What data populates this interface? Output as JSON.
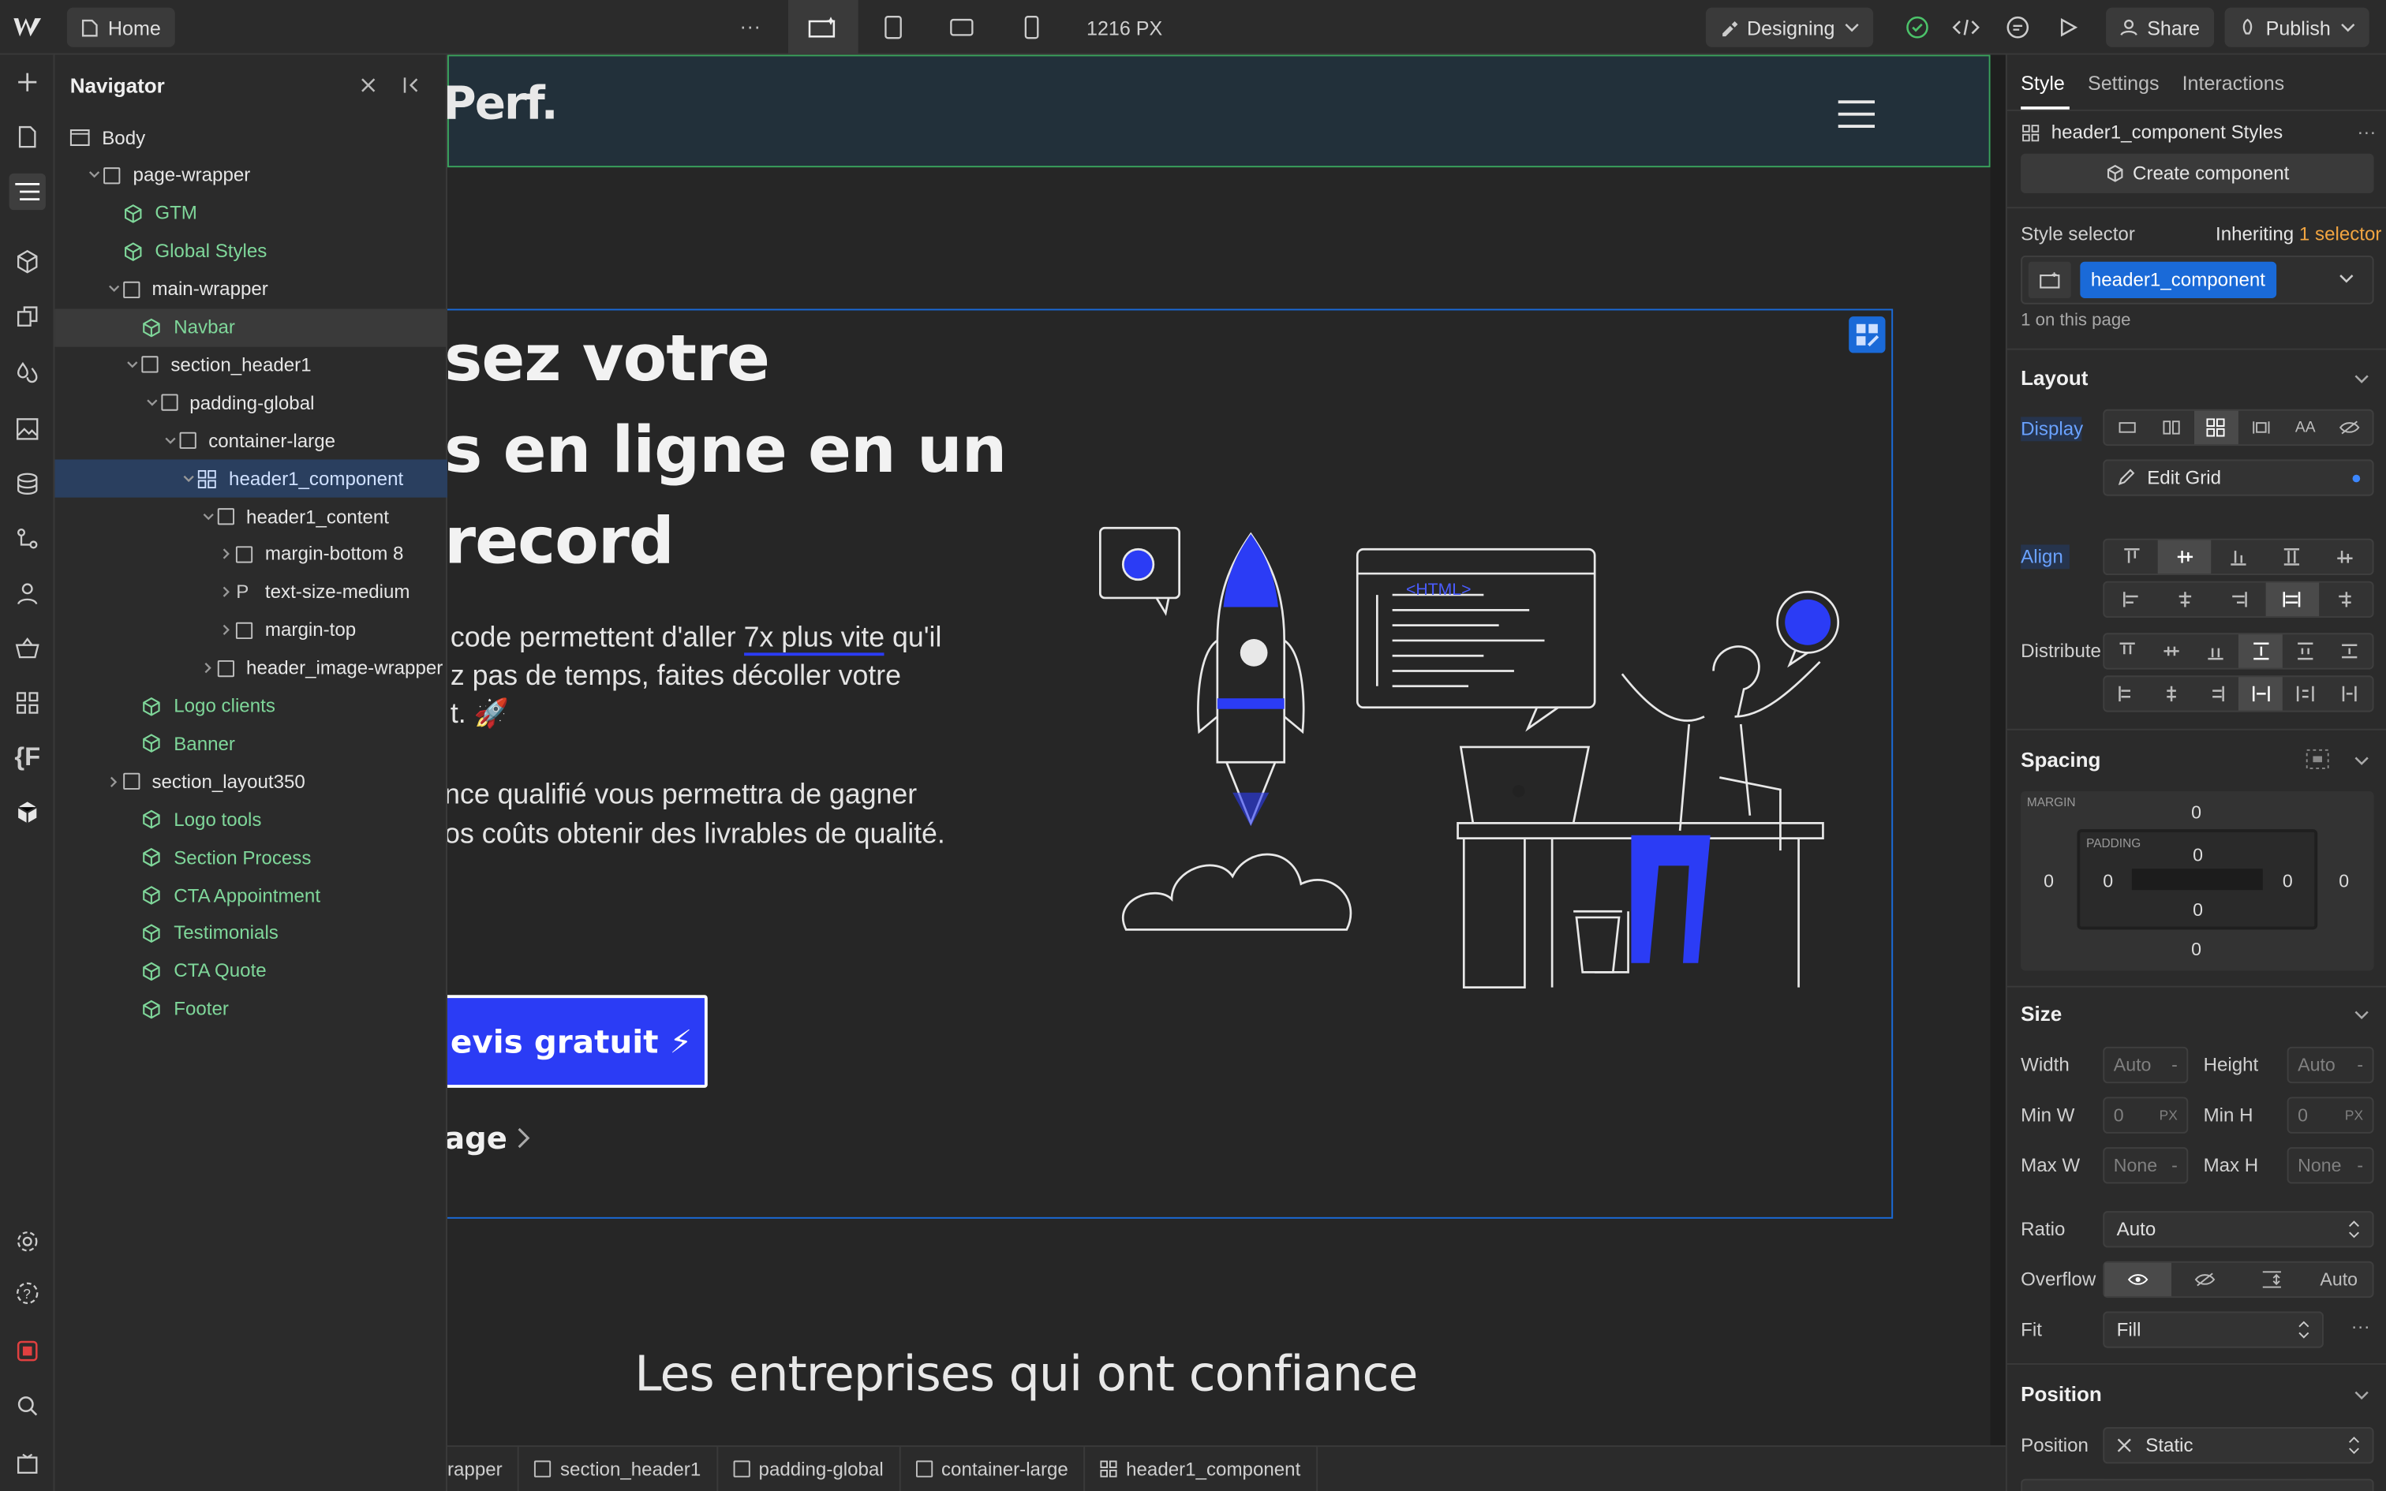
{
  "topbar": {
    "home_label": "Home",
    "more": "···",
    "width_label": "1216 PX",
    "mode_label": "Designing",
    "share_label": "Share",
    "publish_label": "Publish"
  },
  "navigator": {
    "title": "Navigator",
    "items": [
      {
        "label": "Body"
      },
      {
        "label": "page-wrapper"
      },
      {
        "label": "GTM"
      },
      {
        "label": "Global Styles"
      },
      {
        "label": "main-wrapper"
      },
      {
        "label": "Navbar"
      },
      {
        "label": "section_header1"
      },
      {
        "label": "padding-global"
      },
      {
        "label": "container-large"
      },
      {
        "label": "header1_component"
      },
      {
        "label": "header1_content"
      },
      {
        "label": "margin-bottom 8"
      },
      {
        "label": "text-size-medium",
        "prefix": "P"
      },
      {
        "label": "margin-top"
      },
      {
        "label": "header_image-wrapper"
      },
      {
        "label": "Logo clients"
      },
      {
        "label": "Banner"
      },
      {
        "label": "section_layout350"
      },
      {
        "label": "Logo tools"
      },
      {
        "label": "Section Process"
      },
      {
        "label": "CTA Appointment"
      },
      {
        "label": "Testimonials"
      },
      {
        "label": "CTA Quote"
      },
      {
        "label": "Footer"
      }
    ]
  },
  "canvas": {
    "logo_text": "Perf.",
    "heading_lines": [
      "sez votre",
      "s en ligne en un",
      "record"
    ],
    "para1_a": "code permettent d'aller ",
    "para1_link": "7x plus vite",
    "para1_b": " qu'il",
    "para1_line2": "z pas de temps, faites décoller votre",
    "para1_line3": "t. 🚀",
    "para2_line1": "nce qualifié vous permettra de gagner",
    "para2_line2": "os coûts obtenir des livrables de qualité.",
    "cta_label": "evis gratuit ⚡",
    "secondary_link": "age",
    "html_tag": "<HTML>",
    "companies_heading": "Les entreprises qui ont confiance"
  },
  "breadcrumb": [
    "rapper",
    "section_header1",
    "padding-global",
    "container-large",
    "header1_component"
  ],
  "panel": {
    "tabs": [
      "Style",
      "Settings",
      "Interactions"
    ],
    "styles_title": "header1_component Styles",
    "create_component": "Create component",
    "style_selector": "Style selector",
    "inheriting": "Inheriting",
    "inheriting_count": "1 selector",
    "selector_chip": "header1_component",
    "on_page": "1 on this page",
    "layout": "Layout",
    "display": "Display",
    "edit_grid": "Edit Grid",
    "align": "Align",
    "distribute": "Distribute",
    "spacing": "Spacing",
    "margin_label": "MARGIN",
    "padding_label": "PADDING",
    "margin": {
      "top": "0",
      "right": "0",
      "bottom": "0",
      "left": "0"
    },
    "padding": {
      "top": "0",
      "right": "0",
      "bottom": "0",
      "left": "0"
    },
    "size": "Size",
    "width_lbl": "Width",
    "width_val": "Auto",
    "height_lbl": "Height",
    "height_val": "Auto",
    "minw_lbl": "Min W",
    "minw_val": "0",
    "minw_unit": "PX",
    "minh_lbl": "Min H",
    "minh_val": "0",
    "minh_unit": "PX",
    "maxw_lbl": "Max W",
    "maxw_val": "None",
    "maxh_lbl": "Max H",
    "maxh_val": "None",
    "dash": "-",
    "ratio_lbl": "Ratio",
    "ratio_val": "Auto",
    "overflow_lbl": "Overflow",
    "overflow_auto": "Auto",
    "fit_lbl": "Fit",
    "fit_val": "Fill",
    "position": "Position",
    "position_lbl": "Position",
    "position_val": "Static"
  },
  "colors": {
    "accent": "#2b3cf5",
    "selection": "#1a6ad8",
    "component_green": "#7fd79a",
    "inherit_orange": "#f2a541"
  }
}
